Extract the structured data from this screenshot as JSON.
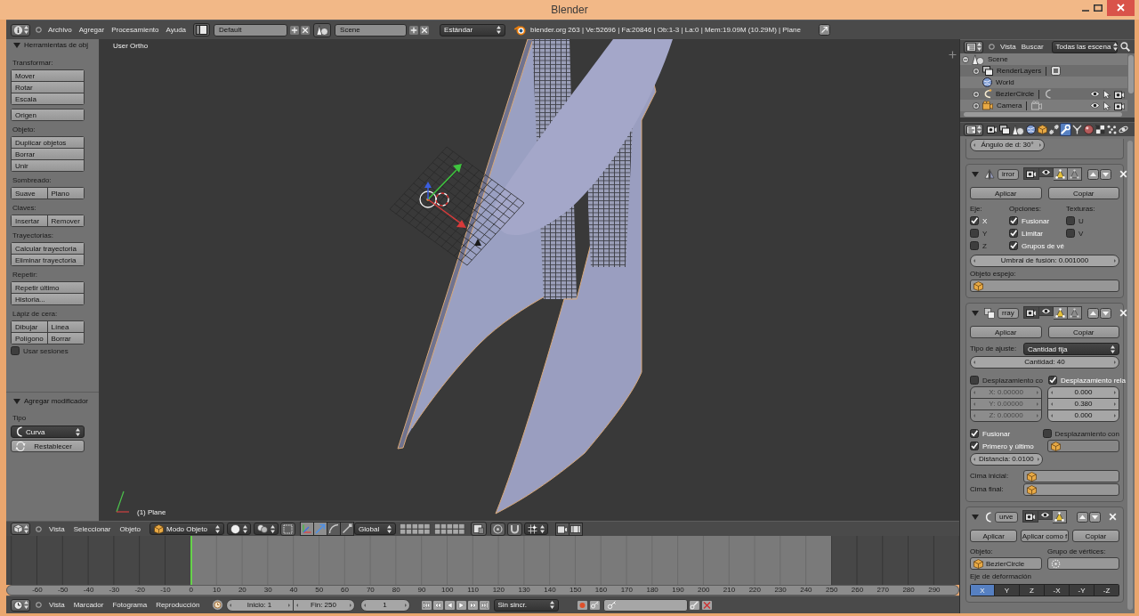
{
  "window": {
    "title": "Blender"
  },
  "info_header": {
    "menus": [
      "Archivo",
      "Agregar",
      "Procesamiento",
      "Ayuda"
    ],
    "layout": "Default",
    "scene": "Scene",
    "engine": "Estándar",
    "stats": "blender.org 263 | Ve:52696 | Fa:20846 | Ob:1-3 | La:0 | Mem:19.09M (10.29M) | Plane"
  },
  "tool_shelf": {
    "title": "Herramientas de obj",
    "expanded": true,
    "sections": [
      {
        "label": "Transformar:",
        "rows": [
          [
            "Mover"
          ],
          [
            "Rotar"
          ],
          [
            "Escala"
          ]
        ]
      },
      {
        "rows": [
          [
            "Origen"
          ]
        ]
      },
      {
        "label": "Objeto:",
        "rows": [
          [
            "Duplicar objetos"
          ],
          [
            "Borrar"
          ],
          [
            "Unir"
          ]
        ]
      },
      {
        "label": "Sombreado:",
        "rows": [
          [
            "Suave",
            "Plano"
          ]
        ]
      },
      {
        "label": "Claves:",
        "rows": [
          [
            "Insertar",
            "Remover"
          ]
        ]
      },
      {
        "label": "Trayectorias:",
        "rows": [
          [
            "Calcular trayectoria"
          ],
          [
            "Eliminar trayectoria"
          ]
        ]
      },
      {
        "label": "Repetir:",
        "rows": [
          [
            "Repetir último"
          ],
          [
            "Historia..."
          ]
        ]
      },
      {
        "label": "Lápiz de cera:",
        "rows": [
          [
            "Dibujar",
            "Línea"
          ],
          [
            "Polígono",
            "Borrar"
          ]
        ],
        "checkbox": {
          "label": "Usar sesiones",
          "checked": false
        }
      }
    ]
  },
  "operator_panel": {
    "title": "Agregar modificador",
    "expanded": true,
    "type_label": "Tipo",
    "type_value": "Curva",
    "reset": "Restablecer"
  },
  "viewport": {
    "view_name": "User Ortho",
    "object_name": "(1) Plane"
  },
  "view3d_header": {
    "menus": [
      "Vista",
      "Seleccionar",
      "Objeto"
    ],
    "mode": "Modo Objeto",
    "orientation": "Global"
  },
  "timeline": {
    "ticks": [
      "-60",
      "-50",
      "-40",
      "-30",
      "-20",
      "-10",
      "0",
      "10",
      "20",
      "30",
      "40",
      "50",
      "60",
      "70",
      "80",
      "90",
      "100",
      "110",
      "120",
      "130",
      "140",
      "150",
      "160",
      "170",
      "180",
      "190",
      "200",
      "210",
      "220",
      "230",
      "240",
      "250",
      "260",
      "270",
      "280",
      "290"
    ]
  },
  "timeline_header": {
    "menus": [
      "Vista",
      "Marcador",
      "Fotograma",
      "Reproducción"
    ],
    "start": "Inicio: 1",
    "end": "Fin: 250",
    "frame": "1",
    "sync": "Sin sincr."
  },
  "outliner": {
    "menus": [
      "Vista",
      "Buscar"
    ],
    "filter": "Todas las escena",
    "tree": [
      {
        "label": "Scene",
        "kind": "scene",
        "expanded": true,
        "children": [
          {
            "label": "RenderLayers",
            "kind": "render_layers",
            "expanded": false
          },
          {
            "label": "World",
            "kind": "world"
          },
          {
            "label": "BezierCircle",
            "kind": "curve",
            "expanded": false
          },
          {
            "label": "Camera",
            "kind": "camera",
            "expanded": false
          }
        ]
      }
    ]
  },
  "properties": {
    "tabs": [
      {
        "kind": "render",
        "selected": false
      },
      {
        "kind": "render_layers",
        "selected": false
      },
      {
        "kind": "scene",
        "selected": false
      },
      {
        "kind": "world",
        "selected": false
      },
      {
        "kind": "object",
        "selected": false
      },
      {
        "kind": "constraints",
        "selected": false
      },
      {
        "kind": "modifiers",
        "selected": true
      },
      {
        "kind": "data",
        "selected": false
      },
      {
        "kind": "material",
        "selected": false
      },
      {
        "kind": "texture",
        "selected": false
      },
      {
        "kind": "particles",
        "selected": false
      },
      {
        "kind": "physics",
        "selected": false
      }
    ],
    "angle_field": "Ángulo de d: 30°",
    "modifiers": [
      {
        "kind": "mirror",
        "name": "irror",
        "expanded": true,
        "toggles": [
          {
            "kind": "render",
            "on": true
          },
          {
            "kind": "realtime",
            "on": true
          },
          {
            "kind": "editmode",
            "on": false
          },
          {
            "kind": "cage",
            "on": false
          }
        ],
        "buttons": [
          "Aplicar",
          "Copiar"
        ],
        "columns": [
          {
            "label": "Eje:",
            "options": [
              {
                "label": "X",
                "checked": true
              },
              {
                "label": "Y",
                "checked": false
              },
              {
                "label": "Z",
                "checked": false
              }
            ]
          },
          {
            "label": "Opciones:",
            "options": [
              {
                "label": "Fusionar",
                "checked": true
              },
              {
                "label": "Limitar",
                "checked": true
              },
              {
                "label": "Grupos de vé",
                "checked": true
              }
            ]
          },
          {
            "label": "Texturas:",
            "options": [
              {
                "label": "U",
                "checked": false
              },
              {
                "label": "V",
                "checked": false
              }
            ]
          }
        ],
        "merge_limit": "Umbral de fusión: 0.001000",
        "mirror_object_label": "Objeto espejo:"
      },
      {
        "kind": "array",
        "name": "rray",
        "expanded": true,
        "toggles": [
          {
            "kind": "render",
            "on": true
          },
          {
            "kind": "realtime",
            "on": true
          },
          {
            "kind": "editmode",
            "on": false
          },
          {
            "kind": "cage",
            "on": false
          }
        ],
        "buttons": [
          "Aplicar",
          "Copiar"
        ],
        "fit_type_label": "Tipo de ajuste:",
        "fit_type": "Cantidad fija",
        "count": "Cantidad: 40",
        "offsets": [
          {
            "label": "Desplazamiento co",
            "checked": false,
            "values": [
              "X: 0.00000",
              "Y: 0.00000",
              "Z: 0.00000"
            ]
          },
          {
            "label": "Desplazamiento rela",
            "checked": true,
            "values": [
              "0.000",
              "0.380",
              "0.000"
            ]
          }
        ],
        "merge": {
          "label": "Fusionar",
          "checked": true
        },
        "object_offset": {
          "label": "Desplazamiento con",
          "checked": false
        },
        "first_last": {
          "label": "Primero y último",
          "checked": true
        },
        "distance": "Distancia: 0.0100",
        "caps": [
          "Cima inicial:",
          "Cima final:"
        ]
      },
      {
        "kind": "curve",
        "name": "urve",
        "expanded": true,
        "toggles": [
          {
            "kind": "render",
            "on": true
          },
          {
            "kind": "realtime",
            "on": true
          },
          {
            "kind": "editmode",
            "on": false
          }
        ],
        "buttons": [
          "Aplicar",
          "Aplicar como f",
          "Copiar"
        ],
        "object_label": "Objeto:",
        "object": "BezierCircle",
        "vertex_group_label": "Grupo de vértices:",
        "axis_label": "Eje de deformación",
        "axes": [
          {
            "label": "X",
            "selected": true
          },
          {
            "label": "Y",
            "selected": false
          },
          {
            "label": "Z",
            "selected": false
          },
          {
            "label": "-X",
            "selected": false
          },
          {
            "label": "-Y",
            "selected": false
          },
          {
            "label": "-Z",
            "selected": false
          }
        ]
      }
    ]
  }
}
